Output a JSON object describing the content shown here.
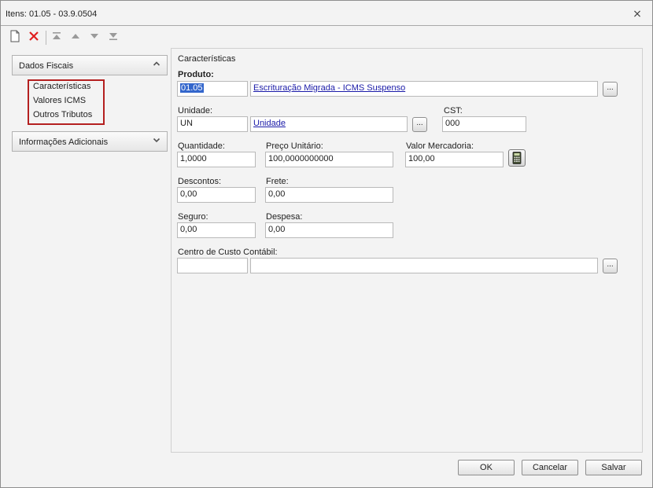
{
  "window": {
    "title": "Itens: 01.05 - 03.9.0504"
  },
  "toolbar": {
    "buttons": [
      "new-document",
      "delete",
      "move-first",
      "move-up",
      "move-down",
      "move-last"
    ]
  },
  "sidebar": {
    "dados_fiscais": "Dados Fiscais",
    "items": [
      "Características",
      "Valores ICMS",
      "Outros Tributos"
    ],
    "informacoes_adicionais": "Informações Adicionais"
  },
  "form": {
    "group_title": "Características",
    "produto": {
      "label": "Produto:",
      "code": "01.05",
      "description": "Escrituração Migrada - ICMS Suspenso"
    },
    "unidade": {
      "label": "Unidade:",
      "code": "UN",
      "description": "Unidade"
    },
    "cst": {
      "label": "CST:",
      "value": "000"
    },
    "quantidade": {
      "label": "Quantidade:",
      "value": "1,0000"
    },
    "preco_unitario": {
      "label": "Preço Unitário:",
      "value": "100,0000000000"
    },
    "valor_mercadoria": {
      "label": "Valor Mercadoria:",
      "value": "100,00"
    },
    "descontos": {
      "label": "Descontos:",
      "value": "0,00"
    },
    "frete": {
      "label": "Frete:",
      "value": "0,00"
    },
    "seguro": {
      "label": "Seguro:",
      "value": "0,00"
    },
    "despesa": {
      "label": "Despesa:",
      "value": "0,00"
    },
    "centro_custo": {
      "label": "Centro de Custo Contábil:",
      "code": "",
      "description": ""
    },
    "lookup_label": "..."
  },
  "footer": {
    "ok": "OK",
    "cancelar": "Cancelar",
    "salvar": "Salvar"
  },
  "colors": {
    "highlight_border": "#b41f1f",
    "selection": "#3366cc",
    "link": "#1a1aa8"
  }
}
